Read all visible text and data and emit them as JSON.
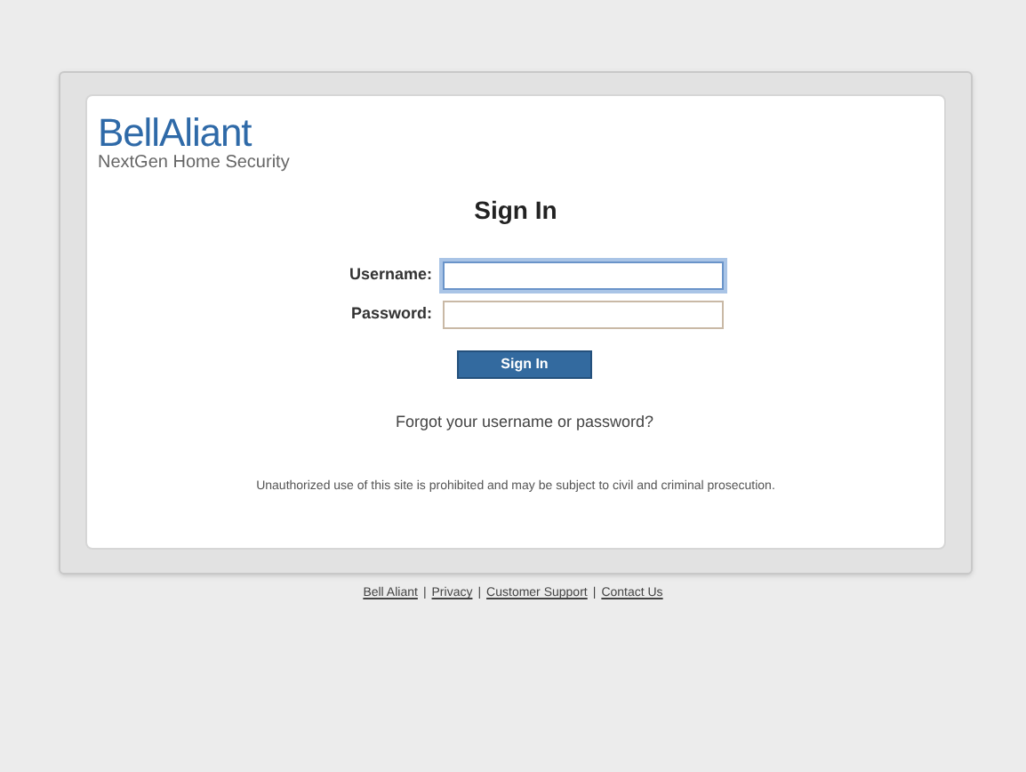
{
  "logo": {
    "wordmark": "**Bell**Aliant",
    "tagline": "NextGen Home Security"
  },
  "form": {
    "title": "Sign In",
    "fields": [
      {
        "label": "Username:",
        "focused": true
      },
      {
        "label": "Password:",
        "focused": false
      }
    ],
    "submit": "Sign In",
    "forgot_link": "Forgot your username or password?"
  },
  "notice": "Unauthorized use of this site is prohibited and may be subject to civil and criminal prosecution.",
  "footer": {
    "separator": "|",
    "links": [
      "Bell Aliant",
      "Privacy",
      "Customer Support",
      "Contact Us"
    ]
  }
}
